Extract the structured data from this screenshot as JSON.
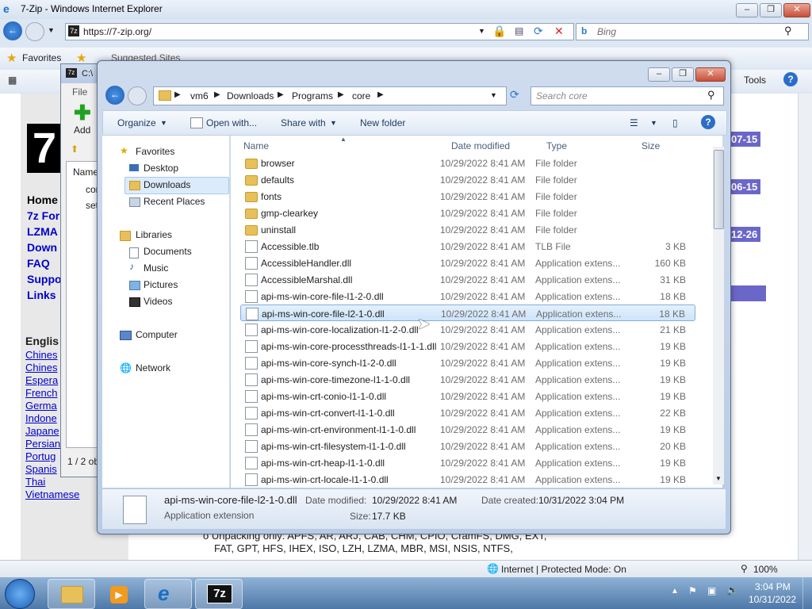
{
  "ie": {
    "title": "7-Zip - Windows Internet Explorer",
    "url": "https://7-zip.org/",
    "search_placeholder": "Bing",
    "favorites_label": "Favorites",
    "suggested_sites": "Suggested Sites",
    "tools_label": "Tools",
    "status_zone": "Internet | Protected Mode: On",
    "zoom": "100%",
    "page_logo": "7",
    "nav_links": [
      "Home",
      "7z For",
      "LZMA",
      "Down",
      "FAQ",
      "Suppo",
      "Links"
    ],
    "lang_heading": "Englis",
    "languages": [
      "Chines",
      "Chines",
      "Espera",
      "French",
      "Germa",
      "Indone",
      "Japane",
      "Persian",
      "Portug",
      "Spanis",
      "Thai",
      "Vietnamese"
    ],
    "dates": [
      "07-15",
      "06-15",
      "12-26"
    ],
    "unpack_text_1": "o  Unpacking only: APFS, AR, ARJ, CAB, CHM, CPIO, CramFS, DMG, EXT,",
    "unpack_text_2": "FAT, GPT, HFS, IHEX, ISO, LZH, LZMA, MBR, MSI, NSIS, NTFS,"
  },
  "z7": {
    "title": "C:\\",
    "file_menu": "File",
    "add_label": "Add",
    "name_col": "Name",
    "items": [
      "cor",
      "set"
    ],
    "status": "1 / 2 ob"
  },
  "explorer": {
    "breadcrumb": [
      "vm6",
      "Downloads",
      "Programs",
      "core"
    ],
    "search_placeholder": "Search core",
    "toolbar": {
      "organize": "Organize",
      "open_with": "Open with...",
      "share_with": "Share with",
      "new_folder": "New folder"
    },
    "nav": {
      "favorites": "Favorites",
      "desktop": "Desktop",
      "downloads": "Downloads",
      "recent": "Recent Places",
      "libraries": "Libraries",
      "documents": "Documents",
      "music": "Music",
      "pictures": "Pictures",
      "videos": "Videos",
      "computer": "Computer",
      "network": "Network"
    },
    "columns": {
      "name": "Name",
      "date": "Date modified",
      "type": "Type",
      "size": "Size"
    },
    "files": [
      {
        "name": "browser",
        "date": "10/29/2022 8:41 AM",
        "type": "File folder",
        "size": "",
        "kind": "folder"
      },
      {
        "name": "defaults",
        "date": "10/29/2022 8:41 AM",
        "type": "File folder",
        "size": "",
        "kind": "folder"
      },
      {
        "name": "fonts",
        "date": "10/29/2022 8:41 AM",
        "type": "File folder",
        "size": "",
        "kind": "folder"
      },
      {
        "name": "gmp-clearkey",
        "date": "10/29/2022 8:41 AM",
        "type": "File folder",
        "size": "",
        "kind": "folder"
      },
      {
        "name": "uninstall",
        "date": "10/29/2022 8:41 AM",
        "type": "File folder",
        "size": "",
        "kind": "folder"
      },
      {
        "name": "Accessible.tlb",
        "date": "10/29/2022 8:41 AM",
        "type": "TLB File",
        "size": "3 KB",
        "kind": "file"
      },
      {
        "name": "AccessibleHandler.dll",
        "date": "10/29/2022 8:41 AM",
        "type": "Application extens...",
        "size": "160 KB",
        "kind": "file"
      },
      {
        "name": "AccessibleMarshal.dll",
        "date": "10/29/2022 8:41 AM",
        "type": "Application extens...",
        "size": "31 KB",
        "kind": "file"
      },
      {
        "name": "api-ms-win-core-file-l1-2-0.dll",
        "date": "10/29/2022 8:41 AM",
        "type": "Application extens...",
        "size": "18 KB",
        "kind": "file"
      },
      {
        "name": "api-ms-win-core-file-l2-1-0.dll",
        "date": "10/29/2022 8:41 AM",
        "type": "Application extens...",
        "size": "18 KB",
        "kind": "file",
        "selected": true
      },
      {
        "name": "api-ms-win-core-localization-l1-2-0.dll",
        "date": "10/29/2022 8:41 AM",
        "type": "Application extens...",
        "size": "21 KB",
        "kind": "file"
      },
      {
        "name": "api-ms-win-core-processthreads-l1-1-1.dll",
        "date": "10/29/2022 8:41 AM",
        "type": "Application extens...",
        "size": "19 KB",
        "kind": "file"
      },
      {
        "name": "api-ms-win-core-synch-l1-2-0.dll",
        "date": "10/29/2022 8:41 AM",
        "type": "Application extens...",
        "size": "19 KB",
        "kind": "file"
      },
      {
        "name": "api-ms-win-core-timezone-l1-1-0.dll",
        "date": "10/29/2022 8:41 AM",
        "type": "Application extens...",
        "size": "19 KB",
        "kind": "file"
      },
      {
        "name": "api-ms-win-crt-conio-l1-1-0.dll",
        "date": "10/29/2022 8:41 AM",
        "type": "Application extens...",
        "size": "19 KB",
        "kind": "file"
      },
      {
        "name": "api-ms-win-crt-convert-l1-1-0.dll",
        "date": "10/29/2022 8:41 AM",
        "type": "Application extens...",
        "size": "22 KB",
        "kind": "file"
      },
      {
        "name": "api-ms-win-crt-environment-l1-1-0.dll",
        "date": "10/29/2022 8:41 AM",
        "type": "Application extens...",
        "size": "19 KB",
        "kind": "file"
      },
      {
        "name": "api-ms-win-crt-filesystem-l1-1-0.dll",
        "date": "10/29/2022 8:41 AM",
        "type": "Application extens...",
        "size": "20 KB",
        "kind": "file"
      },
      {
        "name": "api-ms-win-crt-heap-l1-1-0.dll",
        "date": "10/29/2022 8:41 AM",
        "type": "Application extens...",
        "size": "19 KB",
        "kind": "file"
      },
      {
        "name": "api-ms-win-crt-locale-l1-1-0.dll",
        "date": "10/29/2022 8:41 AM",
        "type": "Application extens...",
        "size": "19 KB",
        "kind": "file"
      }
    ],
    "details": {
      "name": "api-ms-win-core-file-l2-1-0.dll",
      "type": "Application extension",
      "date_modified_label": "Date modified:",
      "date_modified": "10/29/2022 8:41 AM",
      "date_created_label": "Date created:",
      "date_created": "10/31/2022 3:04 PM",
      "size_label": "Size:",
      "size": "17.7 KB"
    }
  },
  "taskbar": {
    "time": "3:04 PM",
    "date": "10/31/2022",
    "app_label": "7z"
  }
}
